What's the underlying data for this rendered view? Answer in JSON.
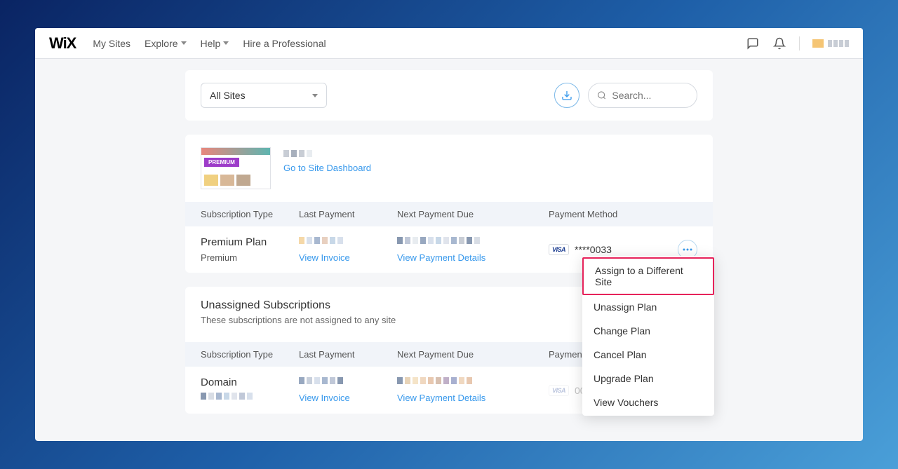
{
  "nav": {
    "logo": "WiX",
    "items": [
      "My Sites",
      "Explore",
      "Help",
      "Hire a Professional"
    ]
  },
  "filter": {
    "site_select": "All Sites",
    "search_placeholder": "Search..."
  },
  "site": {
    "dashboard_link": "Go to Site Dashboard",
    "thumb_badge": "PREMIUM"
  },
  "table_headers": {
    "type": "Subscription Type",
    "last": "Last Payment",
    "next": "Next Payment Due",
    "method": "Payment Method"
  },
  "rows": [
    {
      "title": "Premium Plan",
      "sub": "Premium",
      "invoice_link": "View Invoice",
      "details_link": "View Payment Details",
      "card_brand": "VISA",
      "card_last": "****0033"
    }
  ],
  "unassigned": {
    "title": "Unassigned Subscriptions",
    "sub": "These subscriptions are not assigned to any site",
    "rows": [
      {
        "title": "Domain",
        "invoice_link": "View Invoice",
        "details_link": "View Payment Details",
        "card_brand": "VISA",
        "card_last": "0033"
      }
    ]
  },
  "menu": {
    "items": [
      "Assign to a Different Site",
      "Unassign Plan",
      "Change Plan",
      "Cancel Plan",
      "Upgrade Plan",
      "View Vouchers"
    ]
  }
}
